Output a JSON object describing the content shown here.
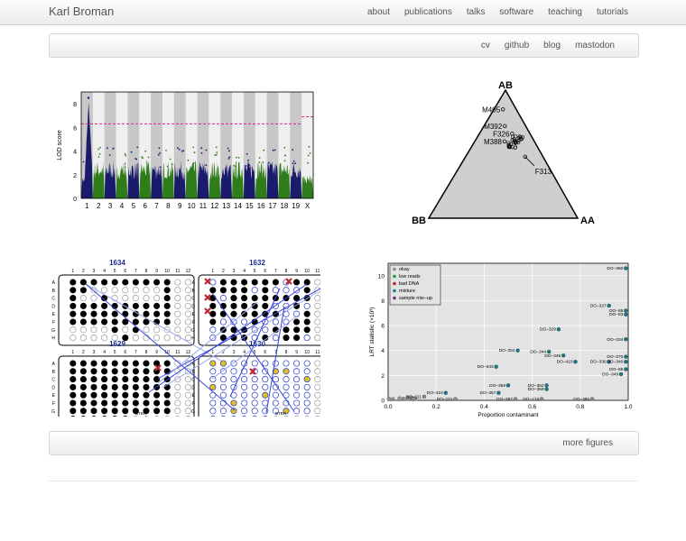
{
  "site": {
    "brand": "Karl Broman"
  },
  "topnav": [
    {
      "label": "about",
      "name": "nav-about"
    },
    {
      "label": "publications",
      "name": "nav-publications"
    },
    {
      "label": "talks",
      "name": "nav-talks"
    },
    {
      "label": "software",
      "name": "nav-software"
    },
    {
      "label": "teaching",
      "name": "nav-teaching"
    },
    {
      "label": "tutorials",
      "name": "nav-tutorials"
    }
  ],
  "subnav": [
    {
      "label": "cv",
      "name": "subnav-cv"
    },
    {
      "label": "github",
      "name": "subnav-github"
    },
    {
      "label": "blog",
      "name": "subnav-blog"
    },
    {
      "label": "mastodon",
      "name": "subnav-mastodon"
    }
  ],
  "more_figures": "more figures",
  "chart_data": [
    {
      "type": "scatter",
      "title": "",
      "ylabel": "LOD score",
      "ylim": [
        0,
        9
      ],
      "yticks": [
        0,
        2,
        4,
        6,
        8
      ],
      "chromosomes": [
        "1",
        "2",
        "3",
        "4",
        "5",
        "6",
        "7",
        "8",
        "9",
        "10",
        "11",
        "12",
        "13",
        "14",
        "15",
        "16",
        "17",
        "18",
        "19",
        "X"
      ],
      "threshold_autosome": 6.3,
      "threshold_x": 6.9,
      "peak": {
        "chromosome": "1",
        "lod": 8.5
      },
      "colors": {
        "odd": "#1b1b6b",
        "even": "#2e7d1a",
        "threshold": "#e0218a",
        "band": "#c8c8c8"
      }
    },
    {
      "type": "scatter",
      "title": "",
      "vertices": [
        "AB",
        "BB",
        "AA"
      ],
      "labeled_points": [
        {
          "label": "M405",
          "ab": 0.85,
          "bb": 0.09,
          "aa": 0.06
        },
        {
          "label": "M392",
          "ab": 0.72,
          "bb": 0.14,
          "aa": 0.14
        },
        {
          "label": "F326",
          "ab": 0.66,
          "bb": 0.12,
          "aa": 0.22
        },
        {
          "label": "M388",
          "ab": 0.6,
          "bb": 0.2,
          "aa": 0.2
        },
        {
          "label": "F313",
          "ab": 0.48,
          "bb": 0.12,
          "aa": 0.4
        }
      ]
    },
    {
      "type": "scatter",
      "title": "",
      "plates": [
        {
          "id": "1634",
          "rows": [
            "A",
            "B",
            "C",
            "D",
            "E",
            "F",
            "G",
            "H"
          ],
          "cols": 12
        },
        {
          "id": "1632",
          "rows": [
            "A",
            "B",
            "C",
            "D",
            "E",
            "F",
            "G",
            "H"
          ],
          "cols": 12
        },
        {
          "id": "1629",
          "rows": [
            "A",
            "B",
            "C",
            "D",
            "E",
            "F",
            "G",
            "H"
          ],
          "cols": 12
        },
        {
          "id": "1630",
          "rows": [
            "A",
            "B",
            "C",
            "D",
            "E",
            "F",
            "G",
            "H"
          ],
          "cols": 12
        }
      ],
      "well_label": "BTBR"
    },
    {
      "type": "scatter",
      "title": "",
      "xlabel": "Proportion contaminant",
      "ylabel": "LRT statistic (×10³)",
      "xlim": [
        0,
        1
      ],
      "ylim": [
        0,
        11
      ],
      "xticks": [
        0.0,
        0.2,
        0.4,
        0.6,
        0.8,
        1.0
      ],
      "yticks": [
        0,
        2,
        4,
        6,
        8,
        10
      ],
      "legend": {
        "placement": "top-left",
        "entries": [
          "okay",
          "low reads",
          "bad DNA",
          "mixture",
          "sample mix–up"
        ]
      },
      "points": [
        {
          "label": "DO–360",
          "x": 0.99,
          "y": 10.6,
          "status": "mixture"
        },
        {
          "label": "DO–327",
          "x": 0.92,
          "y": 7.6,
          "status": "mixture"
        },
        {
          "label": "DO–88",
          "x": 0.99,
          "y": 7.2,
          "status": "mixture"
        },
        {
          "label": "DO–83",
          "x": 0.99,
          "y": 6.9,
          "status": "mixture"
        },
        {
          "label": "DO–329",
          "x": 0.71,
          "y": 5.7,
          "status": "mixture"
        },
        {
          "label": "DO–334",
          "x": 0.99,
          "y": 4.9,
          "status": "mixture"
        },
        {
          "label": "DO–354",
          "x": 0.54,
          "y": 4.0,
          "status": "mixture"
        },
        {
          "label": "DO–344",
          "x": 0.67,
          "y": 3.9,
          "status": "mixture"
        },
        {
          "label": "DO–346",
          "x": 0.73,
          "y": 3.6,
          "status": "mixture"
        },
        {
          "label": "DO–370",
          "x": 0.99,
          "y": 3.5,
          "status": "mixture"
        },
        {
          "label": "DO–410",
          "x": 0.78,
          "y": 3.1,
          "status": "mixture"
        },
        {
          "label": "DO–336",
          "x": 0.92,
          "y": 3.1,
          "status": "mixture"
        },
        {
          "label": "DO–340",
          "x": 0.99,
          "y": 3.1,
          "status": "mixture"
        },
        {
          "label": "DO–343",
          "x": 0.45,
          "y": 2.7,
          "status": "mixture"
        },
        {
          "label": "DO–85",
          "x": 0.99,
          "y": 2.5,
          "status": "mixture"
        },
        {
          "label": "DO–349",
          "x": 0.97,
          "y": 2.1,
          "status": "mixture"
        },
        {
          "label": "DO–358",
          "x": 0.5,
          "y": 1.2,
          "status": "mixture"
        },
        {
          "label": "DO–362",
          "x": 0.66,
          "y": 1.2,
          "status": "mixture"
        },
        {
          "label": "DO–359",
          "x": 0.66,
          "y": 0.9,
          "status": "mixture"
        },
        {
          "label": "DO–324",
          "x": 0.24,
          "y": 0.6,
          "status": "mixture"
        },
        {
          "label": "DO–357",
          "x": 0.46,
          "y": 0.6,
          "status": "mixture"
        },
        {
          "label": "DO–111",
          "x": 0.15,
          "y": 0.3,
          "status": "okay"
        },
        {
          "label": "DO–101",
          "x": 0.28,
          "y": 0.1,
          "status": "okay"
        },
        {
          "label": "DO–397",
          "x": 0.53,
          "y": 0.1,
          "status": "okay"
        },
        {
          "label": "DO–174",
          "x": 0.64,
          "y": 0.1,
          "status": "okay"
        },
        {
          "label": "DO–385",
          "x": 0.85,
          "y": 0.1,
          "status": "okay"
        }
      ]
    }
  ]
}
